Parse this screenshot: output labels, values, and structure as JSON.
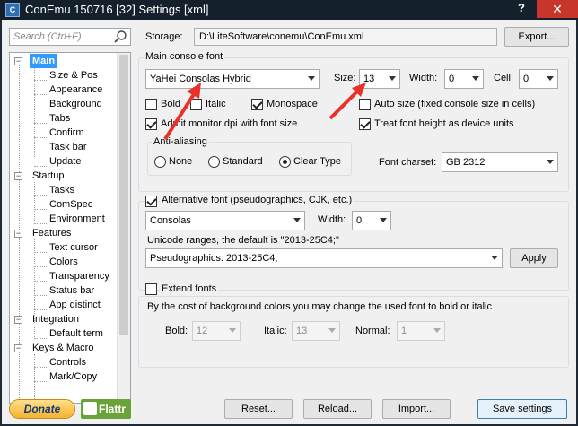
{
  "window": {
    "title": "ConEmu 150716 [32] Settings [xml]",
    "help": "?",
    "close": "✕"
  },
  "search": {
    "placeholder": "Search (Ctrl+F)"
  },
  "tree": {
    "items": [
      {
        "label": "Main",
        "selected": true
      },
      {
        "label": "Size & Pos"
      },
      {
        "label": "Appearance"
      },
      {
        "label": "Background"
      },
      {
        "label": "Tabs"
      },
      {
        "label": "Confirm"
      },
      {
        "label": "Task bar"
      },
      {
        "label": "Update"
      },
      {
        "label": "Startup"
      },
      {
        "label": "Tasks"
      },
      {
        "label": "ComSpec"
      },
      {
        "label": "Environment"
      },
      {
        "label": "Features"
      },
      {
        "label": "Text cursor"
      },
      {
        "label": "Colors"
      },
      {
        "label": "Transparency"
      },
      {
        "label": "Status bar"
      },
      {
        "label": "App distinct"
      },
      {
        "label": "Integration"
      },
      {
        "label": "Default term"
      },
      {
        "label": "Keys & Macro"
      },
      {
        "label": "Controls"
      },
      {
        "label": "Mark/Copy"
      }
    ]
  },
  "storage": {
    "label": "Storage:",
    "path": "D:\\LiteSoftware\\conemu\\ConEmu.xml",
    "export_button": "Export..."
  },
  "main_font": {
    "group_title": "Main console font",
    "font_name": "YaHei Consolas Hybrid",
    "size_label": "Size:",
    "size_value": "13",
    "width_label": "Width:",
    "width_value": "0",
    "cell_label": "Cell:",
    "cell_value": "0",
    "bold_label": "Bold",
    "bold_checked": false,
    "italic_label": "Italic",
    "italic_checked": false,
    "monospace_label": "Monospace",
    "monospace_checked": true,
    "autosize_label": "Auto size (fixed console size in cells)",
    "autosize_checked": false,
    "admit_dpi_label": "Admit monitor dpi with font size",
    "admit_dpi_checked": true,
    "treat_height_label": "Treat font height as device units",
    "treat_height_checked": true,
    "antialiasing": {
      "title": "Anti-aliasing",
      "options": [
        "None",
        "Standard",
        "Clear Type"
      ],
      "selected": "Clear Type"
    },
    "charset_label": "Font charset:",
    "charset_value": "GB 2312"
  },
  "alt_font": {
    "checkbox_label": "Alternative font (pseudographics, CJK, etc.)",
    "checked": true,
    "font_name": "Consolas",
    "width_label": "Width:",
    "width_value": "0",
    "unicode_label": "Unicode ranges, the default is \"2013-25C4;\"",
    "unicode_value": "Pseudographics: 2013-25C4;",
    "apply_button": "Apply"
  },
  "extend_fonts": {
    "checkbox_label": "Extend fonts",
    "checked": false,
    "description": "By the cost of background colors you may change the used font to bold or italic",
    "bold_label": "Bold:",
    "bold_value": "12",
    "italic_label": "Italic:",
    "italic_value": "13",
    "normal_label": "Normal:",
    "normal_value": "1"
  },
  "footer": {
    "donate": "Donate",
    "flattr": "Flattr",
    "reset": "Reset...",
    "reload": "Reload...",
    "import": "Import...",
    "save": "Save settings"
  },
  "colors": {
    "accent": "#3399ff",
    "annotation_arrow": "#e8312a",
    "titlebar": "#14202c",
    "close": "#c7352b"
  }
}
